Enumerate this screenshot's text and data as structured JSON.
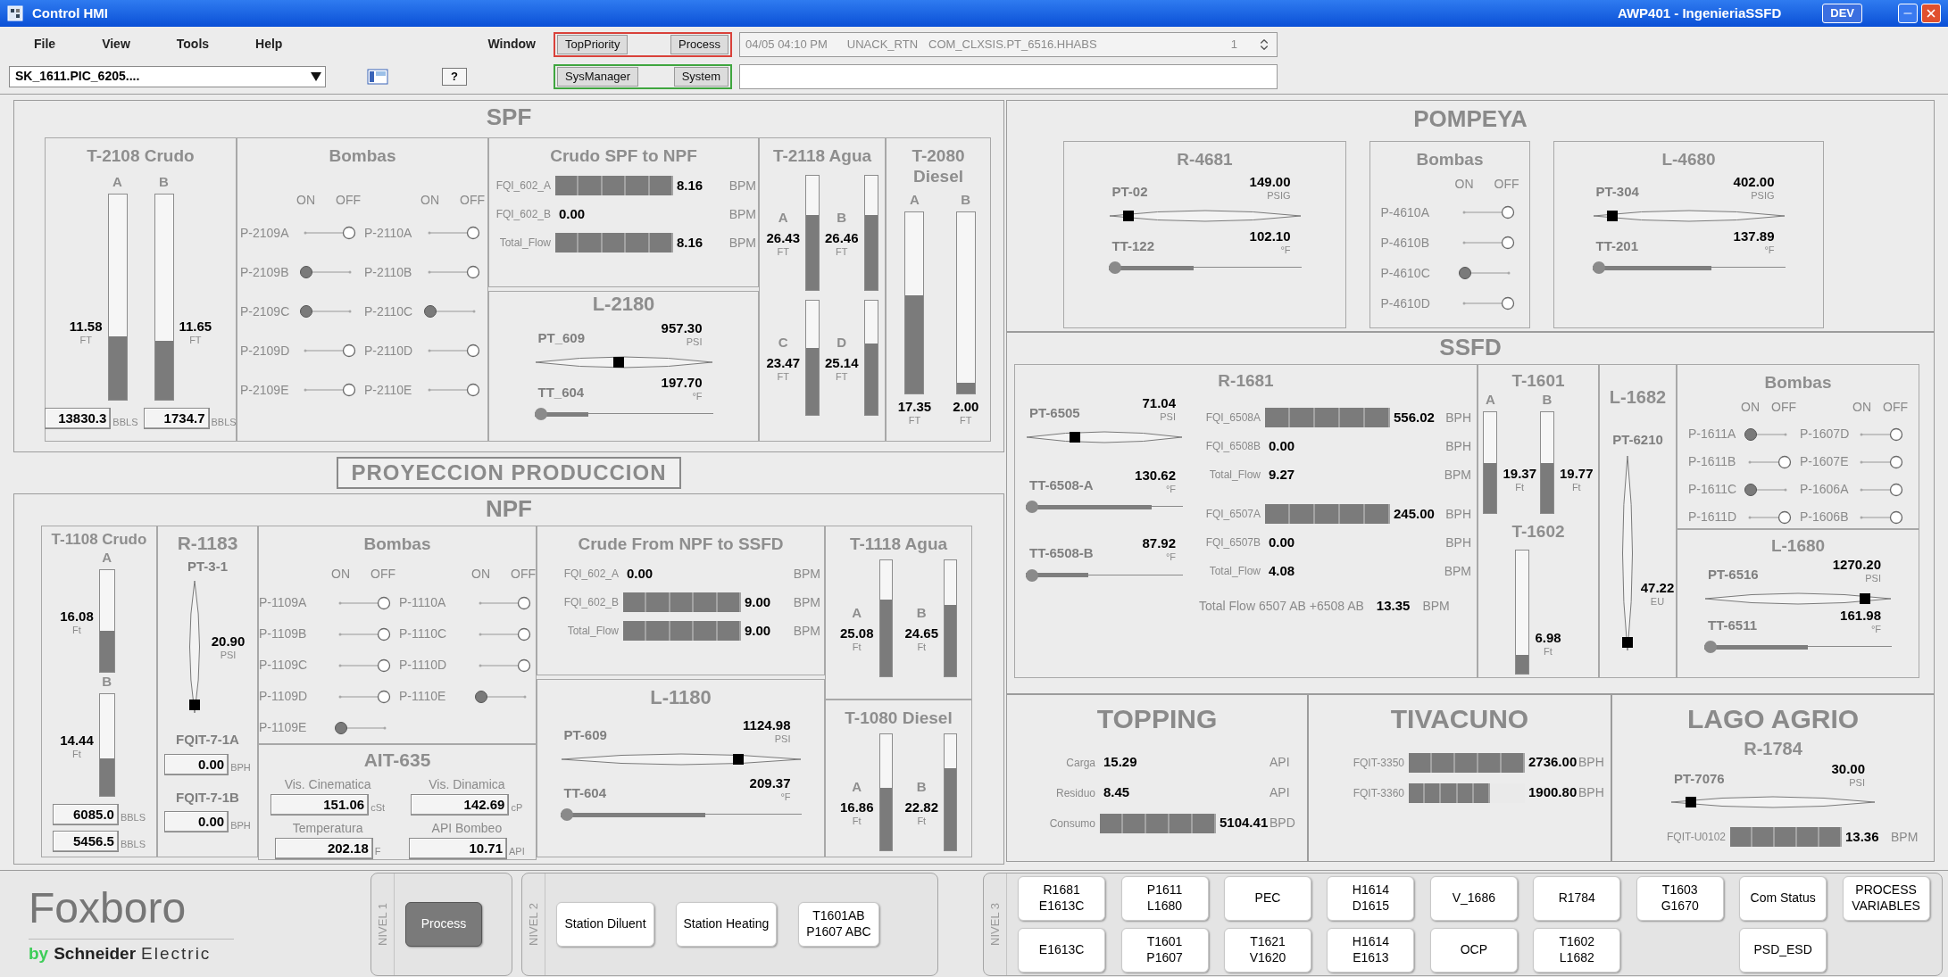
{
  "window": {
    "title": "Control HMI",
    "station": "AWP401 - IngenieriaSSFD",
    "badge": "DEV"
  },
  "menu": [
    "File",
    "View",
    "Tools",
    "Help",
    "Window"
  ],
  "tag_field": {
    "value": "SK_1611.PIC_6205...."
  },
  "help_button": "?",
  "alarm_groups": [
    {
      "color": "#d9413a",
      "buttons": [
        "TopPriority",
        "Process"
      ]
    },
    {
      "color": "#3fa63f",
      "buttons": [
        "SysManager",
        "System"
      ]
    }
  ],
  "alarm_line": {
    "time": "04/05 04:10 PM",
    "state": "UNACK_RTN",
    "tag": "COM_CLXSIS.PT_6516.HHABS",
    "count": "1"
  },
  "spf": {
    "title": "SPF",
    "crude_tanks": {
      "title": "T-2108 Crudo",
      "tanks": [
        {
          "label": "A",
          "value": "11.58",
          "unit": "FT",
          "level": 0.31
        },
        {
          "label": "B",
          "value": "11.65",
          "unit": "FT",
          "level": 0.29
        }
      ],
      "totals": [
        {
          "value": "13830.3",
          "unit": "BBLS"
        },
        {
          "value": "1734.7",
          "unit": "BBLS"
        }
      ]
    },
    "pumps": {
      "title": "Bombas",
      "columns": [
        {
          "on_label": "ON",
          "off_label": "OFF",
          "pumps": [
            {
              "name": "P-2109A",
              "on": false
            },
            {
              "name": "P-2109B",
              "on": true
            },
            {
              "name": "P-2109C",
              "on": true
            },
            {
              "name": "P-2109D",
              "on": false
            },
            {
              "name": "P-2109E",
              "on": false
            }
          ]
        },
        {
          "on_label": "ON",
          "off_label": "OFF",
          "pumps": [
            {
              "name": "P-2110A",
              "on": false
            },
            {
              "name": "P-2110B",
              "on": false
            },
            {
              "name": "P-2110C",
              "on": true
            },
            {
              "name": "P-2110D",
              "on": false
            },
            {
              "name": "P-2110E",
              "on": false
            }
          ]
        }
      ]
    },
    "flows": {
      "title": "Crudo SPF to NPF",
      "rows": [
        {
          "tag": "FQI_602_A",
          "value": "8.16",
          "unit": "BPM",
          "level": 1
        },
        {
          "tag": "FQI_602_B",
          "value": "0.00",
          "unit": "BPM"
        },
        {
          "tag": "Total_Flow",
          "value": "8.16",
          "unit": "BPM",
          "level": 1
        }
      ]
    },
    "line": {
      "title": "L-2180",
      "pressure": {
        "tag": "PT_609",
        "value": "957.30",
        "unit": "PSI",
        "level": 0.47
      },
      "temperature": {
        "tag": "TT_604",
        "value": "197.70",
        "unit": "°F",
        "level": 0.3
      }
    },
    "water_tanks": {
      "title": "T-2118 Agua",
      "tanks": [
        {
          "label": "A",
          "value": "26.43",
          "unit": "FT",
          "level": 0.66
        },
        {
          "label": "B",
          "value": "26.46",
          "unit": "FT",
          "level": 0.66
        },
        {
          "label": "C",
          "value": "23.47",
          "unit": "FT",
          "level": 0.59
        },
        {
          "label": "D",
          "value": "25.14",
          "unit": "FT",
          "level": 0.63
        }
      ]
    },
    "diesel_tanks": {
      "title": "T-2080 Diesel",
      "tanks": [
        {
          "label": "A",
          "value": "17.35",
          "unit": "FT",
          "level": 0.54
        },
        {
          "label": "B",
          "value": "2.00",
          "unit": "FT",
          "level": 0.06
        }
      ]
    }
  },
  "projection_button": "PROYECCION PRODUCCION",
  "npf": {
    "title": "NPF",
    "crude_tanks": {
      "title": "T-1108 Crudo",
      "tanks": [
        {
          "label": "A",
          "value": "16.08",
          "unit": "Ft",
          "level": 0.4
        },
        {
          "label": "B",
          "value": "14.44",
          "unit": "Ft",
          "level": 0.37
        }
      ],
      "totals": [
        {
          "value": "6085.0",
          "unit": "BBLS"
        },
        {
          "value": "5456.5",
          "unit": "BBLS"
        }
      ]
    },
    "reactor": {
      "title": "R-1183",
      "pressure": {
        "tag": "PT-3-1",
        "value": "20.90",
        "unit": "PSI"
      },
      "flows": [
        {
          "tag": "FQIT-7-1A",
          "value": "0.00",
          "unit": "BPH"
        },
        {
          "tag": "FQIT-7-1B",
          "value": "0.00",
          "unit": "BPH"
        }
      ]
    },
    "pumps": {
      "title": "Bombas",
      "columns": [
        {
          "on_label": "ON",
          "off_label": "OFF",
          "pumps": [
            {
              "name": "P-1109A",
              "on": false
            },
            {
              "name": "P-1109B",
              "on": false
            },
            {
              "name": "P-1109C",
              "on": false
            },
            {
              "name": "P-1109D",
              "on": false
            },
            {
              "name": "P-1109E",
              "on": true
            }
          ]
        },
        {
          "on_label": "ON",
          "off_label": "OFF",
          "pumps": [
            {
              "name": "P-1110A",
              "on": false
            },
            {
              "name": "P-1110C",
              "on": false
            },
            {
              "name": "P-1110D",
              "on": false
            },
            {
              "name": "P-1110E",
              "on": true
            }
          ]
        }
      ]
    },
    "analyzer": {
      "title": "AIT-635",
      "fields": [
        {
          "label": "Vis. Cinematica",
          "value": "151.06",
          "unit": "cSt"
        },
        {
          "label": "Vis. Dinamica",
          "value": "142.69",
          "unit": "cP"
        },
        {
          "label": "Temperatura",
          "value": "202.18",
          "unit": "F"
        },
        {
          "label": "API Bombeo",
          "value": "10.71",
          "unit": "API"
        }
      ]
    },
    "flows": {
      "title": "Crude From NPF to SSFD",
      "rows": [
        {
          "tag": "FQI_602_A",
          "value": "0.00",
          "unit": "BPM"
        },
        {
          "tag": "FQI_602_B",
          "value": "9.00",
          "unit": "BPM",
          "level": 1
        },
        {
          "tag": "Total_Flow",
          "value": "9.00",
          "unit": "BPM",
          "level": 1
        }
      ]
    },
    "line": {
      "title": "L-1180",
      "pressure": {
        "tag": "PT-609",
        "value": "1124.98",
        "unit": "PSI",
        "level": 0.75
      },
      "temperature": {
        "tag": "TT-604",
        "value": "209.37",
        "unit": "°F",
        "level": 0.6
      }
    },
    "water_tanks": {
      "title": "T-1118 Agua",
      "tanks": [
        {
          "label": "A",
          "value": "25.08",
          "unit": "Ft",
          "level": 0.66
        },
        {
          "label": "B",
          "value": "24.65",
          "unit": "Ft",
          "level": 0.62
        }
      ]
    },
    "diesel_tanks": {
      "title": "T-1080 Diesel",
      "tanks": [
        {
          "label": "A",
          "value": "16.86",
          "unit": "Ft",
          "level": 0.54
        },
        {
          "label": "B",
          "value": "22.82",
          "unit": "Ft",
          "level": 0.71
        }
      ]
    }
  },
  "pompeya": {
    "title": "POMPEYA",
    "reactor": {
      "title": "R-4681",
      "pressure": {
        "tag": "PT-02",
        "value": "149.00",
        "unit": "PSIG",
        "level": 0.08
      },
      "temperature": {
        "tag": "TT-122",
        "value": "102.10",
        "unit": "°F",
        "level": 0.44
      }
    },
    "pumps": {
      "title": "Bombas",
      "columns": [
        {
          "on_label": "ON",
          "off_label": "OFF",
          "pumps": [
            {
              "name": "P-4610A",
              "on": false
            },
            {
              "name": "P-4610B",
              "on": false
            },
            {
              "name": "P-4610C",
              "on": true
            },
            {
              "name": "P-4610D",
              "on": false
            }
          ]
        }
      ]
    },
    "line": {
      "title": "L-4680",
      "pressure": {
        "tag": "PT-304",
        "value": "402.00",
        "unit": "PSIG",
        "level": 0.08
      },
      "temperature": {
        "tag": "TT-201",
        "value": "137.89",
        "unit": "°F",
        "level": 0.62
      }
    }
  },
  "ssfd": {
    "title": "SSFD",
    "reactor": {
      "title": "R-1681",
      "pressure": {
        "tag": "PT-6505",
        "value": "71.04",
        "unit": "PSI",
        "level": 0.3
      },
      "temperatures": [
        {
          "tag": "TT-6508-A",
          "value": "130.62",
          "unit": "°F",
          "level": 0.8
        },
        {
          "tag": "TT-6508-B",
          "value": "87.92",
          "unit": "°F",
          "level": 0.4
        }
      ],
      "flow_groups": [
        [
          {
            "tag": "FQI_6508A",
            "value": "556.02",
            "unit": "BPH",
            "level": 1
          },
          {
            "tag": "FQI_6508B",
            "value": "0.00",
            "unit": "BPH"
          },
          {
            "tag": "Total_Flow",
            "value": "9.27",
            "unit": "BPM"
          }
        ],
        [
          {
            "tag": "FQI_6507A",
            "value": "245.00",
            "unit": "BPH",
            "level": 1
          },
          {
            "tag": "FQI_6507B",
            "value": "0.00",
            "unit": "BPH"
          },
          {
            "tag": "Total_Flow",
            "value": "4.08",
            "unit": "BPM"
          }
        ]
      ],
      "total": {
        "label": "Total Flow 6507 AB +6508 AB",
        "value": "13.35",
        "unit": "BPM"
      }
    },
    "tank_1601": {
      "title": "T-1601",
      "tanks": [
        {
          "label": "A",
          "value": "19.37",
          "unit": "Ft",
          "level": 0.5
        },
        {
          "label": "B",
          "value": "19.77",
          "unit": "Ft",
          "level": 0.5
        }
      ]
    },
    "tank_1602": {
      "title": "T-1602",
      "tanks": [
        {
          "value": "6.98",
          "unit": "Ft",
          "level": 0.15
        }
      ]
    },
    "line_1682": {
      "title": "L-1682",
      "pressure": {
        "tag": "PT-6210",
        "value": "47.22",
        "unit": "EU"
      }
    },
    "pumps": {
      "title": "Bombas",
      "columns": [
        {
          "on_label": "ON",
          "off_label": "OFF",
          "pumps": [
            {
              "name": "P-1611A",
              "on": true
            },
            {
              "name": "P-1611B",
              "on": false
            },
            {
              "name": "P-1611C",
              "on": true
            },
            {
              "name": "P-1611D",
              "on": false
            }
          ]
        },
        {
          "on_label": "ON",
          "off_label": "OFF",
          "pumps": [
            {
              "name": "P-1607D",
              "on": false
            },
            {
              "name": "P-1607E",
              "on": false
            },
            {
              "name": "P-1606A",
              "on": false
            },
            {
              "name": "P-1606B",
              "on": false
            }
          ]
        }
      ]
    },
    "line_1680": {
      "title": "L-1680",
      "pressure": {
        "tag": "PT-6516",
        "value": "1270.20",
        "unit": "PSI",
        "level": 0.88
      },
      "temperature": {
        "tag": "TT-6511",
        "value": "161.98",
        "unit": "°F",
        "level": 0.55
      }
    }
  },
  "topping": {
    "title": "TOPPING",
    "rows": [
      {
        "tag": "Carga",
        "value": "15.29",
        "unit": "API"
      },
      {
        "tag": "Residuo",
        "value": "8.45",
        "unit": "API"
      },
      {
        "tag": "Consumo",
        "value": "5104.41",
        "unit": "BPD",
        "level": 1
      }
    ]
  },
  "tivacuno": {
    "title": "TIVACUNO",
    "rows": [
      {
        "tag": "FQIT-3350",
        "value": "2736.00",
        "unit": "BPH",
        "level": 1
      },
      {
        "tag": "FQIT-3360",
        "value": "1900.80",
        "unit": "BPH",
        "level": 0.7
      }
    ]
  },
  "lago_agrio": {
    "title": "LAGO AGRIO",
    "subtitle": "R-1784",
    "pressure": {
      "tag": "PT-7076",
      "value": "30.00",
      "unit": "PSI",
      "level": 0.08
    },
    "rows": [
      {
        "tag": "FQIT-U0102",
        "value": "13.36",
        "unit": "BPM",
        "level": 1
      }
    ]
  },
  "footer": {
    "logo": "Foxboro",
    "tagline_parts": [
      "by",
      "Schneider",
      "Electric"
    ],
    "levels": [
      {
        "label": "NIVEL 1",
        "rows": [
          [
            {
              "label": "Process",
              "selected": true
            }
          ]
        ]
      },
      {
        "label": "NIVEL 2",
        "rows": [
          [
            {
              "label": "Station Diluent",
              "selected": false
            },
            {
              "label": "Station Heating",
              "selected": false
            },
            {
              "label": "T1601AB\nP1607 ABC",
              "selected": false
            }
          ]
        ]
      },
      {
        "label": "NIVEL 3",
        "rows": [
          [
            {
              "label": "R1681\nE1613C",
              "selected": false
            },
            {
              "label": "P1611\nL1680",
              "selected": false
            },
            {
              "label": "PEC",
              "selected": false
            },
            {
              "label": "H1614\nD1615",
              "selected": false
            },
            {
              "label": "V_1686",
              "selected": false
            },
            {
              "label": "R1784",
              "selected": false
            },
            {
              "label": "T1603\nG1670",
              "selected": false
            },
            {
              "label": "Com Status",
              "selected": false
            },
            {
              "label": "PROCESS\nVARIABLES",
              "selected": false
            }
          ],
          [
            {
              "label": "E1613C",
              "selected": false
            },
            {
              "label": "T1601\nP1607",
              "selected": false
            },
            {
              "label": "T1621\nV1620",
              "selected": false
            },
            {
              "label": "H1614\nE1613",
              "selected": false
            },
            {
              "label": "OCP",
              "selected": false
            },
            {
              "label": "T1602\nL1682",
              "selected": false
            },
            "",
            {
              "label": "PSD_ESD",
              "selected": false
            }
          ]
        ]
      }
    ]
  }
}
